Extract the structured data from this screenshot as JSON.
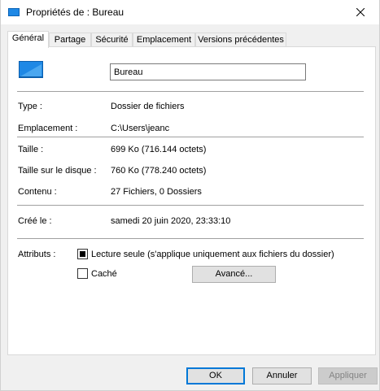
{
  "window": {
    "title": "Propriétés de : Bureau"
  },
  "tabs": [
    {
      "label": "Général",
      "active": true
    },
    {
      "label": "Partage",
      "active": false
    },
    {
      "label": "Sécurité",
      "active": false
    },
    {
      "label": "Emplacement",
      "active": false
    },
    {
      "label": "Versions précédentes",
      "active": false
    }
  ],
  "general": {
    "folder_name": "Bureau",
    "rows": {
      "type": {
        "label": "Type :",
        "value": "Dossier de fichiers"
      },
      "location": {
        "label": "Emplacement :",
        "value": "C:\\Users\\jeanc"
      },
      "size": {
        "label": "Taille :",
        "value": "699 Ko (716.144 octets)"
      },
      "size_on_disk": {
        "label": "Taille sur le disque :",
        "value": "760 Ko (778.240 octets)"
      },
      "contents": {
        "label": "Contenu :",
        "value": "27 Fichiers, 0 Dossiers"
      },
      "created": {
        "label": "Créé le :",
        "value": "samedi 20 juin 2020, 23:33:10"
      }
    },
    "attributes": {
      "label": "Attributs :",
      "read_only": {
        "label": "Lecture seule (s'applique uniquement aux fichiers du dossier)",
        "state": "indeterminate"
      },
      "hidden": {
        "label": "Caché",
        "checked": false
      },
      "advanced_button": "Avancé..."
    }
  },
  "footer": {
    "ok": "OK",
    "cancel": "Annuler",
    "apply": "Appliquer"
  },
  "colors": {
    "accent": "#0078d7",
    "folder_blue": "#1e88e5",
    "panel_bg": "#ffffff",
    "window_bg": "#f0f0f0"
  },
  "icons": {
    "title": "folder-desktop-icon",
    "close": "close-icon",
    "folder": "desktop-folder-icon"
  }
}
